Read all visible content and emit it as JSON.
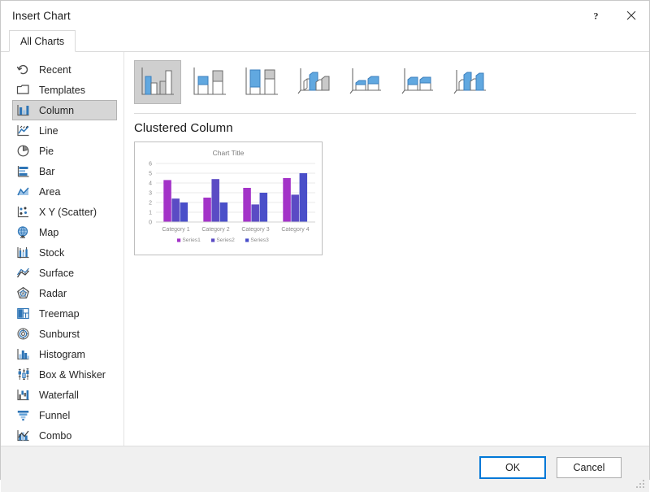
{
  "window": {
    "title": "Insert Chart",
    "help_label": "?",
    "close_label": "✕"
  },
  "tabs": [
    {
      "label": "All Charts",
      "selected": true
    }
  ],
  "sidebar": {
    "items": [
      {
        "label": "Recent",
        "icon": "recent-icon",
        "selected": false
      },
      {
        "label": "Templates",
        "icon": "templates-icon",
        "selected": false
      },
      {
        "label": "Column",
        "icon": "column-icon",
        "selected": true
      },
      {
        "label": "Line",
        "icon": "line-icon",
        "selected": false
      },
      {
        "label": "Pie",
        "icon": "pie-icon",
        "selected": false
      },
      {
        "label": "Bar",
        "icon": "bar-icon",
        "selected": false
      },
      {
        "label": "Area",
        "icon": "area-icon",
        "selected": false
      },
      {
        "label": "X Y (Scatter)",
        "icon": "scatter-icon",
        "selected": false
      },
      {
        "label": "Map",
        "icon": "map-icon",
        "selected": false
      },
      {
        "label": "Stock",
        "icon": "stock-icon",
        "selected": false
      },
      {
        "label": "Surface",
        "icon": "surface-icon",
        "selected": false
      },
      {
        "label": "Radar",
        "icon": "radar-icon",
        "selected": false
      },
      {
        "label": "Treemap",
        "icon": "treemap-icon",
        "selected": false
      },
      {
        "label": "Sunburst",
        "icon": "sunburst-icon",
        "selected": false
      },
      {
        "label": "Histogram",
        "icon": "histogram-icon",
        "selected": false
      },
      {
        "label": "Box & Whisker",
        "icon": "box-whisker-icon",
        "selected": false
      },
      {
        "label": "Waterfall",
        "icon": "waterfall-icon",
        "selected": false
      },
      {
        "label": "Funnel",
        "icon": "funnel-icon",
        "selected": false
      },
      {
        "label": "Combo",
        "icon": "combo-icon",
        "selected": false
      }
    ]
  },
  "gallery": {
    "thumbnails": [
      {
        "name": "Clustered Column",
        "selected": true
      },
      {
        "name": "Stacked Column",
        "selected": false
      },
      {
        "name": "100% Stacked Column",
        "selected": false
      },
      {
        "name": "3-D Clustered Column",
        "selected": false
      },
      {
        "name": "3-D Stacked Column",
        "selected": false
      },
      {
        "name": "3-D 100% Stacked Column",
        "selected": false
      },
      {
        "name": "3-D Column",
        "selected": false
      }
    ]
  },
  "preview": {
    "heading": "Clustered Column"
  },
  "chart_data": {
    "type": "bar",
    "title": "Chart Title",
    "xlabel": "",
    "ylabel": "",
    "ylim": [
      0,
      6
    ],
    "yticks": [
      0,
      1,
      2,
      3,
      4,
      5,
      6
    ],
    "grid": true,
    "legend_position": "bottom",
    "categories": [
      "Category 1",
      "Category 2",
      "Category 3",
      "Category 4"
    ],
    "series": [
      {
        "name": "Series1",
        "color": "#a333c8",
        "values": [
          4.3,
          2.5,
          3.5,
          4.5
        ]
      },
      {
        "name": "Series2",
        "color": "#5b4bc4",
        "values": [
          2.4,
          4.4,
          1.8,
          2.8
        ]
      },
      {
        "name": "Series3",
        "color": "#4a4fc9",
        "values": [
          2.0,
          2.0,
          3.0,
          5.0
        ]
      }
    ]
  },
  "footer": {
    "ok_label": "OK",
    "cancel_label": "Cancel"
  }
}
